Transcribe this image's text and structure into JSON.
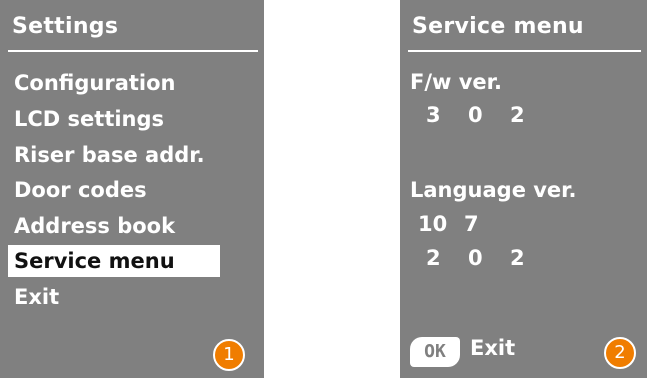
{
  "settings": {
    "title": "Settings",
    "items": [
      {
        "label": "Configuration"
      },
      {
        "label": "LCD settings"
      },
      {
        "label": "Riser base addr."
      },
      {
        "label": "Door codes"
      },
      {
        "label": "Address book"
      },
      {
        "label": "Service menu",
        "selected": true
      },
      {
        "label": "Exit"
      }
    ],
    "badge": "1"
  },
  "service": {
    "title": "Service menu",
    "fw_label": "F/w ver.",
    "fw_values": [
      "3",
      "0",
      "2"
    ],
    "lang_label": "Language ver.",
    "lang_values_line1": [
      "10",
      "7"
    ],
    "lang_values_line2": [
      "2",
      "0",
      "2"
    ],
    "ok_key": "OK",
    "exit_label": "Exit",
    "badge": "2"
  },
  "colors": {
    "screen_bg": "#808080",
    "text": "#ffffff",
    "badge": "#f07d00"
  }
}
